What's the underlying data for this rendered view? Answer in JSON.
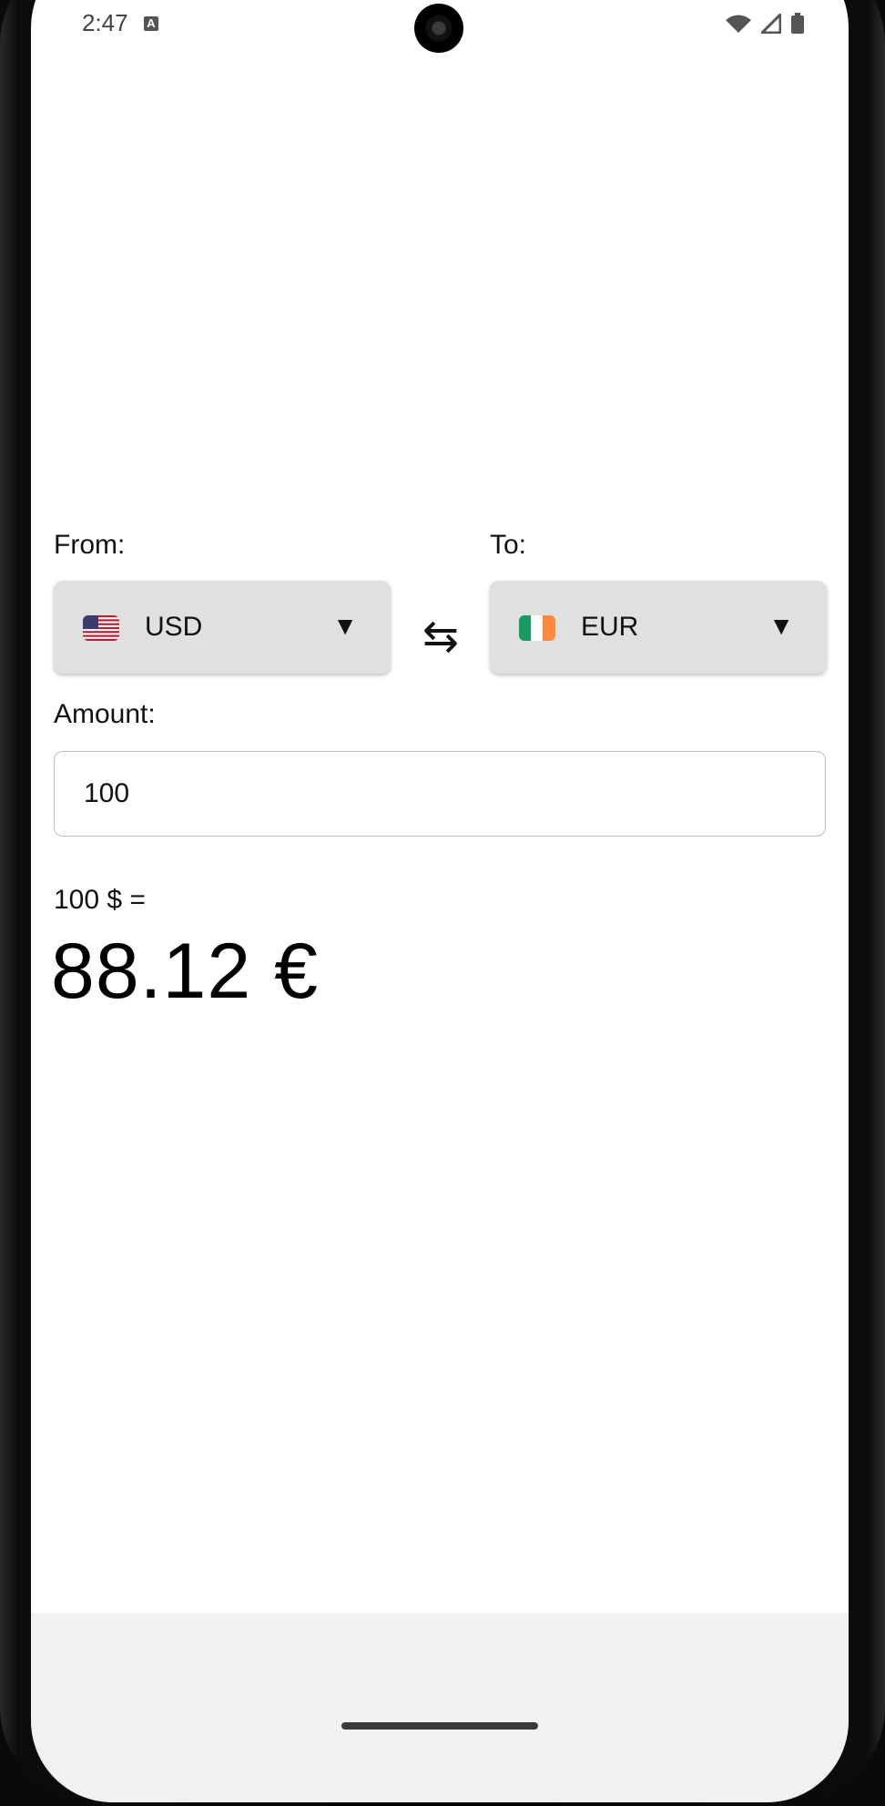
{
  "status_bar": {
    "time": "2:47",
    "notification_icon": "A"
  },
  "converter": {
    "from_label": "From:",
    "to_label": "To:",
    "from_currency": "USD",
    "from_flag_icon": "us-flag-icon",
    "to_currency": "EUR",
    "to_flag_icon": "ireland-flag-icon",
    "dropdown_caret": "▼",
    "swap_glyph": "⇆",
    "amount_label": "Amount:",
    "amount_value": "100",
    "result_prefix": "100 $ =",
    "result_value": "88.12 €"
  },
  "colors": {
    "select_bg": "#e0e0e0",
    "nav_bg": "#f1f1f1"
  }
}
